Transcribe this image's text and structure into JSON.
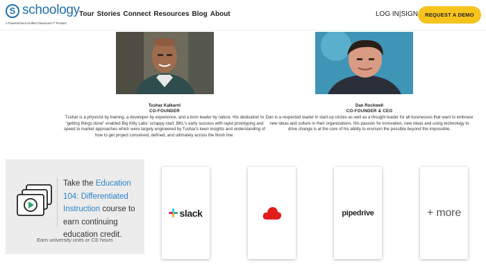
{
  "header": {
    "logo_mark": "S",
    "logo_text": "schoology",
    "logo_tagline": "A PowerSchool Unified Classroom™ Product",
    "nav": [
      "Tour",
      "Stories",
      "Connect",
      "Resources",
      "Blog",
      "About"
    ],
    "login": "LOG IN",
    "separator": "|",
    "signup": "SIGN UP",
    "demo_label": "REQUEST A DEMO",
    "accent": "#f7c31d",
    "brand": "#1f6fa8"
  },
  "founders": [
    {
      "name": "Tushar Kalkarni",
      "role": "CO-FOUNDER",
      "bio": "Tushar is a physicist by training, a developer by experience, and a born leader by nature. His dedication to \"getting things done\" enabled Big Kitty Labs' scrappy start. BKL's early success with rapid prototyping and speed to market approaches which were largely engineered by Tushar's keen insights and understanding of how to get project conceived, defined, and ultimately across the finish line."
    },
    {
      "name": "Dan Rockwell",
      "role": "CO-FOUNDER & CEO",
      "bio": "Dan is a respected leader in start-up circles as well as a thought leader for all businesses that want to embrace new ideas and culture in their organizations. His passion for innovation, new ideas and using technology to drive change is at the core of his ability to envision the possible beyond the impossible."
    }
  ],
  "course": {
    "prefix": "Take the ",
    "highlight": "Education 104: Differentiated Instruction",
    "suffix": " course to earn continuing education credit.",
    "footer": "Earn university units or CE hours",
    "highlight_color": "#2a82c9"
  },
  "integrations": {
    "slack": "slack",
    "pipedrive": "pipedrive",
    "more": "+ more"
  }
}
